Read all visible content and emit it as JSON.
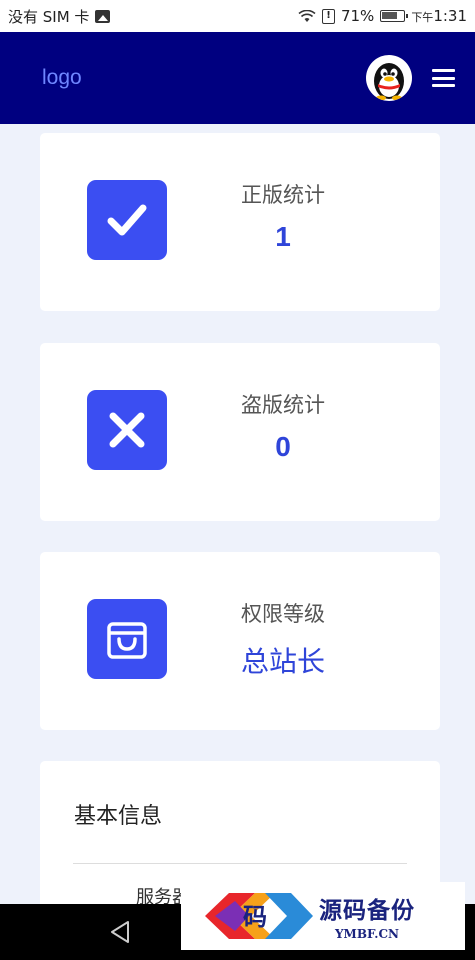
{
  "status_bar": {
    "carrier": "没有 SIM 卡",
    "battery_percent": "71%",
    "time_prefix": "下午",
    "time": "1:31"
  },
  "app_bar": {
    "logo": "logo"
  },
  "cards": [
    {
      "label": "正版统计",
      "value": "1",
      "icon": "check-icon"
    },
    {
      "label": "盗版统计",
      "value": "0",
      "icon": "close-icon"
    },
    {
      "label": "权限等级",
      "value": "总站长",
      "icon": "shopping-bag-icon"
    }
  ],
  "info": {
    "title": "基本信息",
    "row_label": "服务器"
  },
  "watermark": {
    "logo_char": "码",
    "title": "源码备份",
    "subtitle": "YMBF.CN"
  },
  "colors": {
    "app_bar_bg": "#000080",
    "accent": "#3b4ef2",
    "value_text": "#2f45d9",
    "page_bg": "#eef2fb"
  }
}
